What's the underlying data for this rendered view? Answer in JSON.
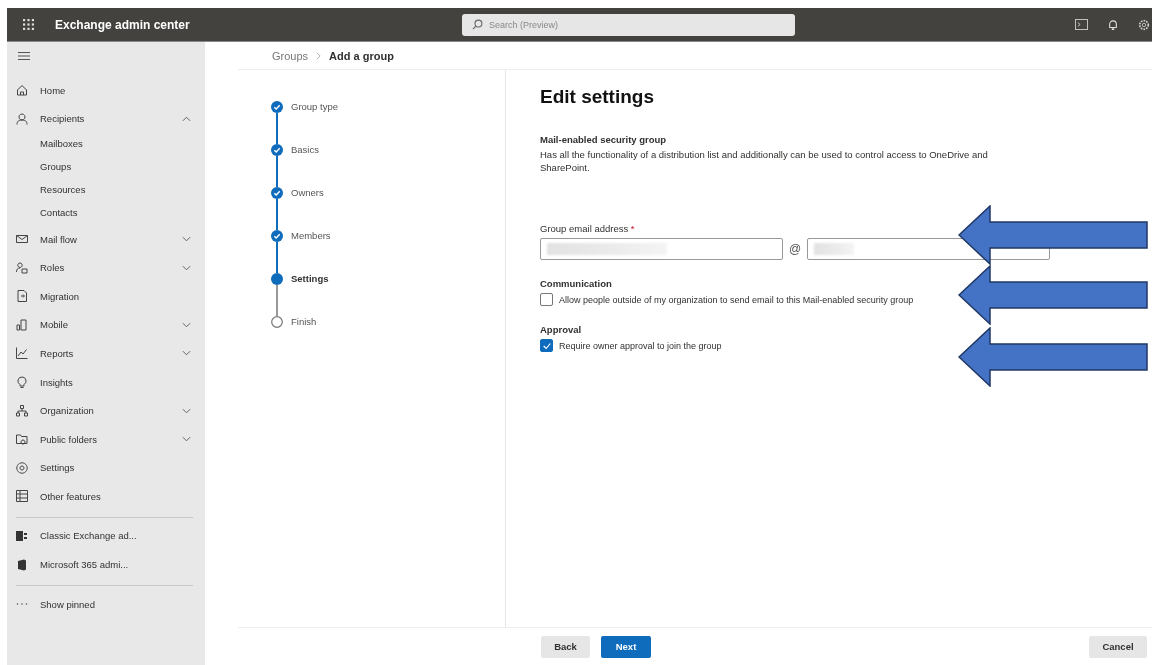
{
  "topbar": {
    "title": "Exchange admin center",
    "search": {
      "placeholder": "Search (Preview)"
    }
  },
  "sidebar": {
    "items": [
      {
        "label": "Home",
        "kind": "home"
      },
      {
        "label": "Recipients",
        "kind": "person",
        "expanded": true,
        "children": [
          {
            "label": "Mailboxes"
          },
          {
            "label": "Groups"
          },
          {
            "label": "Resources"
          },
          {
            "label": "Contacts"
          }
        ]
      },
      {
        "label": "Mail flow",
        "kind": "mail",
        "expanded": false
      },
      {
        "label": "Roles",
        "kind": "roles",
        "expanded": false
      },
      {
        "label": "Migration",
        "kind": "migration"
      },
      {
        "label": "Mobile",
        "kind": "mobile",
        "expanded": false
      },
      {
        "label": "Reports",
        "kind": "chart",
        "expanded": false
      },
      {
        "label": "Insights",
        "kind": "bulb"
      },
      {
        "label": "Organization",
        "kind": "org",
        "expanded": false
      },
      {
        "label": "Public folders",
        "kind": "folder",
        "expanded": false
      },
      {
        "label": "Settings",
        "kind": "gear"
      },
      {
        "label": "Other features",
        "kind": "grid"
      }
    ],
    "pinned": [
      {
        "label": "Classic Exchange ad...",
        "kind": "exchange"
      },
      {
        "label": "Microsoft 365 admi...",
        "kind": "office"
      }
    ],
    "show_pinned": {
      "label": "Show pinned"
    }
  },
  "breadcrumb": [
    {
      "label": "Groups",
      "current": false
    },
    {
      "label": "Add a group",
      "current": true
    }
  ],
  "steps": [
    {
      "label": "Group type",
      "completed": true,
      "selected": false
    },
    {
      "label": "Basics",
      "completed": true,
      "selected": false
    },
    {
      "label": "Owners",
      "completed": true,
      "selected": false
    },
    {
      "label": "Members",
      "completed": true,
      "selected": false
    },
    {
      "label": "Settings",
      "completed": false,
      "selected": true
    },
    {
      "label": "Finish",
      "completed": false,
      "selected": false
    }
  ],
  "form": {
    "title": "Edit settings",
    "group_type": {
      "title": "Mail-enabled security group",
      "description": "Has all the functionality of a distribution list and additionally can be used to control access to OneDrive and SharePoint."
    },
    "email": {
      "label": "Group email address",
      "required_mark": "*",
      "at": "@",
      "name_redacted": true,
      "domain_redacted": true
    },
    "communication": {
      "title": "Communication",
      "label": "Allow people outside of my organization to send email to this Mail-enabled security group",
      "checked": false
    },
    "approval": {
      "title": "Approval",
      "label": "Require owner approval to join the group",
      "checked": true
    }
  },
  "footer": {
    "back": {
      "label": "Back",
      "kind": "secondary"
    },
    "next": {
      "label": "Next",
      "kind": "primary"
    },
    "cancel": {
      "label": "Cancel",
      "kind": "secondary"
    }
  },
  "annotations": [
    {
      "kind": "arrow"
    },
    {
      "kind": "arrow"
    },
    {
      "kind": "arrow"
    }
  ]
}
